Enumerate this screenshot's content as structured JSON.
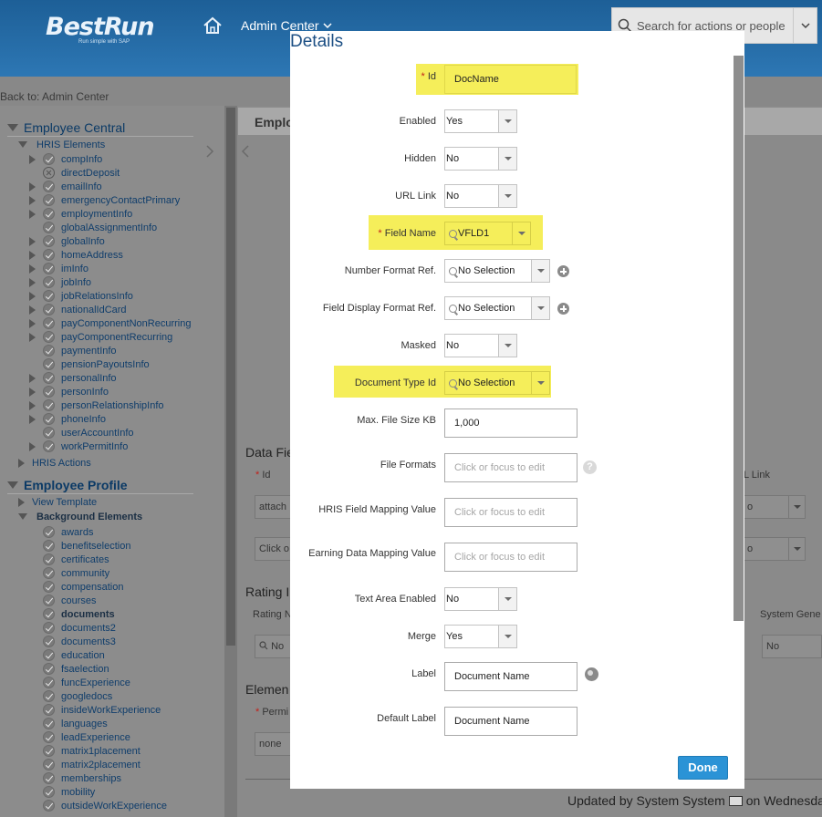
{
  "header": {
    "logo_text": "BestRun",
    "logo_tagline": "Run simple with SAP",
    "nav_title": "Admin Center",
    "search_placeholder": "Search for actions or people",
    "back_link": "Back to: Admin Center"
  },
  "tree": {
    "employee_central": {
      "title": "Employee Central",
      "group": "HRIS Elements",
      "items": [
        "compInfo",
        "directDeposit",
        "emailInfo",
        "emergencyContactPrimary",
        "employmentInfo",
        "globalAssignmentInfo",
        "globalInfo",
        "homeAddress",
        "imInfo",
        "jobInfo",
        "jobRelationsInfo",
        "nationalIdCard",
        "payComponentNonRecurring",
        "payComponentRecurring",
        "paymentInfo",
        "pensionPayoutsInfo",
        "personalInfo",
        "personInfo",
        "personRelationshipInfo",
        "phoneInfo",
        "userAccountInfo",
        "workPermitInfo"
      ],
      "actions": "HRIS Actions"
    },
    "employee_profile": {
      "title": "Employee Profile",
      "view_template": "View Template",
      "group": "Background Elements",
      "items": [
        "awards",
        "benefitselection",
        "certificates",
        "community",
        "compensation",
        "courses",
        "documents",
        "documents2",
        "documents3",
        "education",
        "fsaelection",
        "funcExperience",
        "googledocs",
        "insideWorkExperience",
        "languages",
        "leadExperience",
        "matrix1placement",
        "matrix2placement",
        "memberships",
        "mobility",
        "outsideWorkExperience"
      ]
    }
  },
  "background": {
    "tab": "Emplo",
    "data_fields_heading": "Data Fie",
    "id_label": "Id",
    "id_value": "attach",
    "click_text": "Click o",
    "l_link": "L Link",
    "rating_heading": "Rating I",
    "rating_label": "Rating N",
    "rating_value": "No",
    "system_gen": "System Gene",
    "system_gen_value": "No",
    "element_heading": "Elemen",
    "permi_label": "Permi",
    "permi_value": "none",
    "sel_value": "o",
    "footer": "Updated by System System",
    "footer_tail": "on Wednesda"
  },
  "details": {
    "title": "Details",
    "fields": {
      "id": {
        "label": "Id",
        "value": "DocName"
      },
      "enabled": {
        "label": "Enabled",
        "value": "Yes"
      },
      "hidden": {
        "label": "Hidden",
        "value": "No"
      },
      "url_link": {
        "label": "URL Link",
        "value": "No"
      },
      "field_name": {
        "label": "Field Name",
        "value": "VFLD1"
      },
      "number_format": {
        "label": "Number Format Ref.",
        "value": "No Selection"
      },
      "display_format": {
        "label": "Field Display Format Ref.",
        "value": "No Selection"
      },
      "masked": {
        "label": "Masked",
        "value": "No"
      },
      "doc_type": {
        "label": "Document Type Id",
        "value": "No Selection"
      },
      "max_size": {
        "label": "Max. File Size KB",
        "value": "1,000"
      },
      "file_formats": {
        "label": "File Formats",
        "placeholder": "Click or focus to edit"
      },
      "hris_mapping": {
        "label": "HRIS Field Mapping Value",
        "placeholder": "Click or focus to edit"
      },
      "earning_mapping": {
        "label": "Earning Data Mapping Value",
        "placeholder": "Click or focus to edit"
      },
      "text_area": {
        "label": "Text Area Enabled",
        "value": "No"
      },
      "merge": {
        "label": "Merge",
        "value": "Yes"
      },
      "label": {
        "label": "Label",
        "value": "Document Name"
      },
      "default_label": {
        "label": "Default Label",
        "value": "Document Name"
      }
    },
    "done_label": "Done"
  },
  "colors": {
    "highlight": "#f5ee5a",
    "primary_button": "#2b93d6",
    "header": "#2d77b4",
    "required": "#c3211b"
  }
}
